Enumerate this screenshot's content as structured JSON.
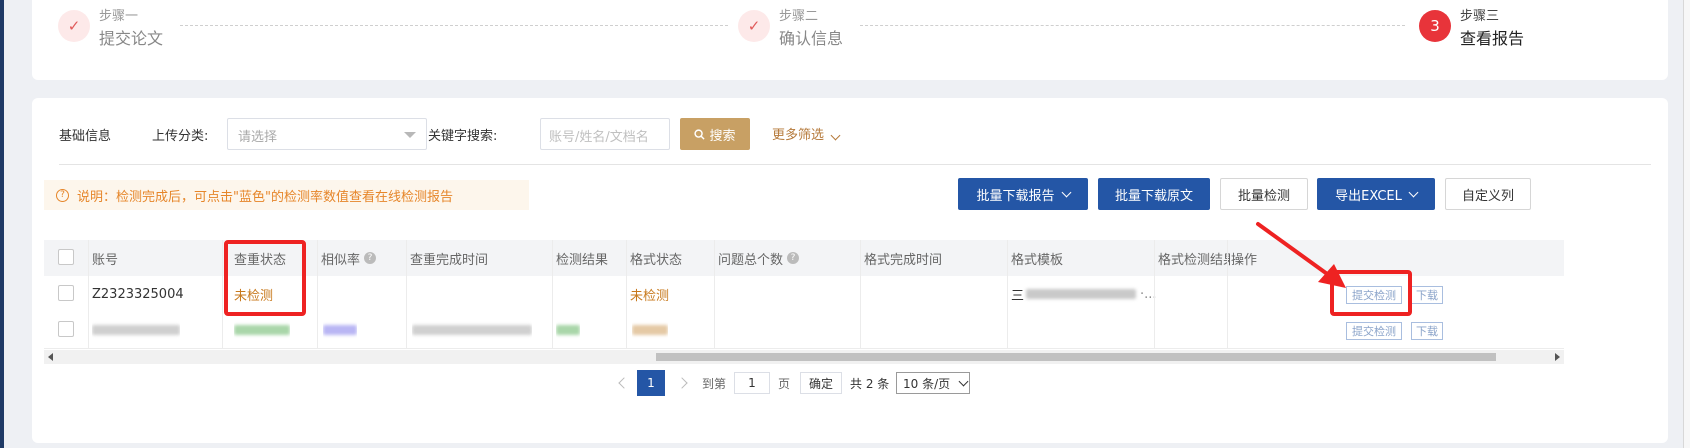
{
  "steps": [
    {
      "number": "✓",
      "small": "步骤一",
      "big": "提交论文",
      "state": "done"
    },
    {
      "number": "✓",
      "small": "步骤二",
      "big": "确认信息",
      "state": "done"
    },
    {
      "number": "3",
      "small": "步骤三",
      "big": "查看报告",
      "state": "current"
    }
  ],
  "filters": {
    "basic_info": "基础信息",
    "upload_category_label": "上传分类:",
    "upload_category_placeholder": "请选择",
    "keyword_label": "关键字搜索:",
    "keyword_placeholder": "账号/姓名/文档名",
    "search_button": "搜索",
    "more_filters": "更多筛选"
  },
  "notice": "说明：检测完成后，可点击\"蓝色\"的检测率数值查看在线检测报告",
  "toolbar": {
    "batch_download_report": "批量下载报告",
    "batch_download_original": "批量下载原文",
    "batch_detect": "批量检测",
    "export_excel": "导出EXCEL",
    "custom_columns": "自定义列"
  },
  "table": {
    "headers": [
      "账号",
      "查重状态",
      "相似率",
      "查重完成时间",
      "检测结果",
      "格式状态",
      "问题总个数",
      "格式完成时间",
      "格式模板",
      "格式检测结果",
      "操作"
    ],
    "rows": [
      {
        "account": "Z2323325004",
        "check_status": "未检测",
        "similarity": "",
        "check_time": "",
        "result": "",
        "format_status": "未检测",
        "issues": "",
        "format_time": "",
        "template": "三",
        "format_result": "",
        "submit": "提交检测",
        "download": "下载"
      },
      {
        "account": "",
        "check_status": "",
        "similarity": "",
        "check_time": "",
        "result": "",
        "format_status": "",
        "issues": "",
        "format_time": "",
        "template": "",
        "format_result": "",
        "submit": "提交检测",
        "download": "下载"
      }
    ]
  },
  "pagination": {
    "current_page": "1",
    "goto_label": "到第",
    "goto_value": "1",
    "page_unit": "页",
    "confirm": "确定",
    "total": "共 2 条",
    "page_size": "10 条/页"
  },
  "colors": {
    "accent_blue": "#2456a6",
    "search_gold": "#c8a064",
    "annotation_red": "#ee2222",
    "status_orange": "#c87a1e"
  }
}
